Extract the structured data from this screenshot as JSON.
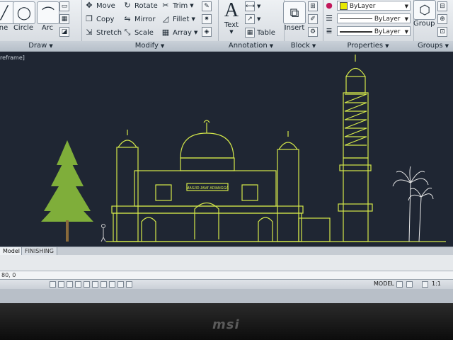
{
  "ribbon": {
    "draw": {
      "title": "Draw",
      "line_label": "ne",
      "circle_label": "Circle",
      "arc_label": "Arc"
    },
    "modify": {
      "title": "Modify",
      "move": "Move",
      "rotate": "Rotate",
      "trim": "Trim",
      "copy": "Copy",
      "mirror": "Mirror",
      "fillet": "Fillet",
      "stretch": "Stretch",
      "scale": "Scale",
      "array": "Array"
    },
    "annotation": {
      "title": "Annotation",
      "text": "Text",
      "table": "Table"
    },
    "block": {
      "title": "Block",
      "insert": "Insert"
    },
    "properties": {
      "title": "Properties",
      "color_value": "ByLayer",
      "linetype_value": "ByLayer",
      "lineweight_value": "ByLayer",
      "color_swatch": "#e8e800"
    },
    "groups": {
      "title": "Groups",
      "group": "Group"
    }
  },
  "viewport": {
    "label": "reframe]"
  },
  "drawing": {
    "signboard": "MASJID JAMI' ADIANGGA",
    "line_color": "#d4e84a",
    "background": "#1f2633"
  },
  "layout_tabs": {
    "model": "Model",
    "finishing": "FINISHING"
  },
  "command": {
    "value": "80, 0"
  },
  "status": {
    "model": "MODEL",
    "scale": "1:1"
  },
  "bezel": {
    "brand": "msi"
  }
}
